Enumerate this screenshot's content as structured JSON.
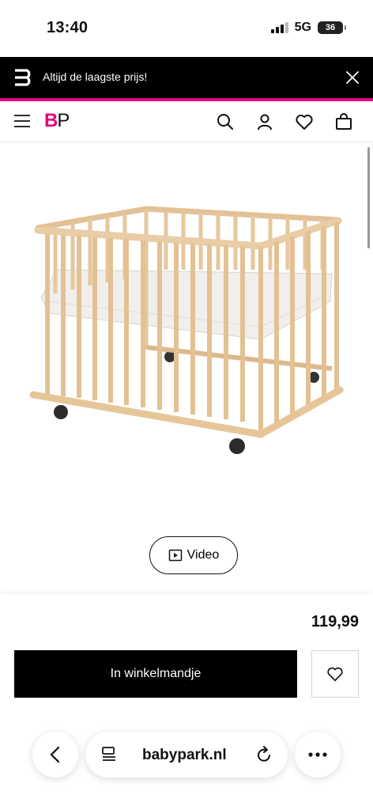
{
  "status_bar": {
    "time": "13:40",
    "network": "5G",
    "battery": "36"
  },
  "promo": {
    "text": "Altijd de laagste prijs!"
  },
  "header": {
    "brand_b": "B",
    "brand_p": "P"
  },
  "product": {
    "video_label": "Video",
    "price": "119,99",
    "cart_label": "In winkelmandje"
  },
  "browser": {
    "url": "babypark.nl"
  },
  "colors": {
    "accent": "#e6007e",
    "wood": "#e8c9a0",
    "dark": "#000000"
  },
  "icons": [
    "promo-logo-icon",
    "close-icon",
    "menu-icon",
    "search-icon",
    "account-icon",
    "heart-icon",
    "bag-icon",
    "play-icon",
    "back-icon",
    "reader-icon",
    "reload-icon",
    "more-icon"
  ]
}
